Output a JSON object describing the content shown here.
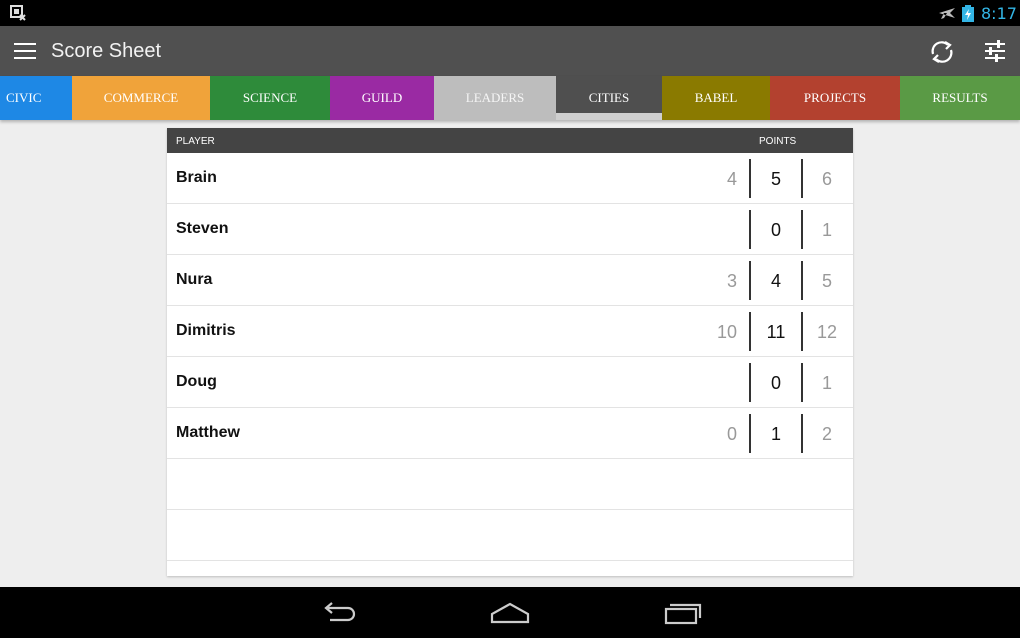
{
  "status_bar": {
    "time": "8:17",
    "notification_icon": "screenshot-notification-icon",
    "airplane_icon": "airplane-mode-icon",
    "battery_icon": "battery-charging-icon",
    "accent_color": "#33b5e5"
  },
  "action_bar": {
    "title": "Score Sheet",
    "menu_icon": "hamburger-menu-icon",
    "sync_icon": "sync-icon",
    "settings_icon": "sliders-settings-icon"
  },
  "tabs": [
    {
      "label": "CIVIC",
      "color": "#1e88e5",
      "width": 72
    },
    {
      "label": "COMMERCE",
      "color": "#f0a33a",
      "width": 138
    },
    {
      "label": "SCIENCE",
      "color": "#2e8b3a",
      "width": 120
    },
    {
      "label": "GUILD",
      "color": "#9a2aa3",
      "width": 104
    },
    {
      "label": "LEADERS",
      "color": "#bdbdbd",
      "width": 122
    },
    {
      "label": "CITIES",
      "color": "#4f4f4f",
      "width": 106,
      "active": true
    },
    {
      "label": "BABEL",
      "color": "#8a7a00",
      "width": 108
    },
    {
      "label": "PROJECTS",
      "color": "#b3412f",
      "width": 130
    },
    {
      "label": "RESULTS",
      "color": "#5a9a45",
      "width": 120
    }
  ],
  "table": {
    "col_player": "PLAYER",
    "col_points": "POINTS",
    "rows": [
      {
        "name": "Brain",
        "prev": "4",
        "cur": "5",
        "next": "6"
      },
      {
        "name": "Steven",
        "prev": "",
        "cur": "0",
        "next": "1"
      },
      {
        "name": "Nura",
        "prev": "3",
        "cur": "4",
        "next": "5"
      },
      {
        "name": "Dimitris",
        "prev": "10",
        "cur": "11",
        "next": "12"
      },
      {
        "name": "Doug",
        "prev": "",
        "cur": "0",
        "next": "1"
      },
      {
        "name": "Matthew",
        "prev": "0",
        "cur": "1",
        "next": "2"
      }
    ]
  },
  "nav_bar": {
    "back_icon": "back-icon",
    "home_icon": "home-icon",
    "recents_icon": "recent-apps-icon"
  }
}
